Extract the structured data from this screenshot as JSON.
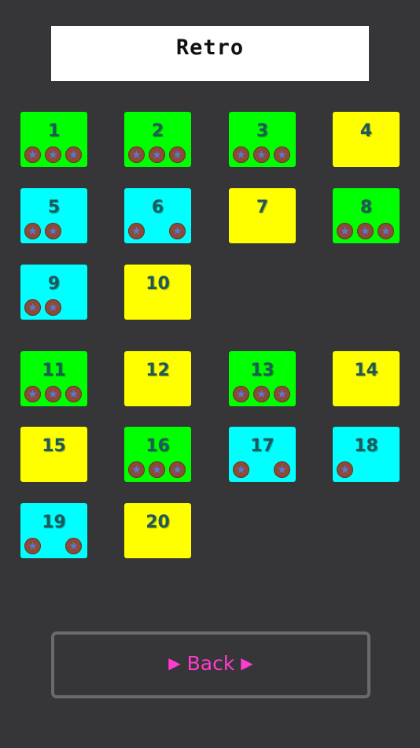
{
  "title": "Retro",
  "colors": {
    "background": "#363537",
    "complete": "#00ff00",
    "partial": "#00ffff",
    "unplayed": "#ffff00",
    "star_coin": "#8a4b38",
    "star": "#5a78d8",
    "back_text": "#ff3ccf"
  },
  "levels": [
    {
      "label": "1",
      "status": "complete",
      "stars": 3
    },
    {
      "label": "2",
      "status": "complete",
      "stars": 3
    },
    {
      "label": "3",
      "status": "complete",
      "stars": 3
    },
    {
      "label": "4",
      "status": "unplayed",
      "stars": 0
    },
    {
      "label": "5",
      "status": "partial",
      "stars": 2
    },
    {
      "label": "6",
      "status": "partial",
      "stars": 2,
      "star_slots": [
        0,
        2
      ]
    },
    {
      "label": "7",
      "status": "unplayed",
      "stars": 0
    },
    {
      "label": "8",
      "status": "complete",
      "stars": 3
    },
    {
      "label": "9",
      "status": "partial",
      "stars": 2
    },
    {
      "label": "10",
      "status": "unplayed",
      "stars": 0
    },
    {
      "label": "11",
      "status": "complete",
      "stars": 3
    },
    {
      "label": "12",
      "status": "unplayed",
      "stars": 0
    },
    {
      "label": "13",
      "status": "complete",
      "stars": 3
    },
    {
      "label": "14",
      "status": "unplayed",
      "stars": 0
    },
    {
      "label": "15",
      "status": "unplayed",
      "stars": 0
    },
    {
      "label": "16",
      "status": "complete",
      "stars": 3
    },
    {
      "label": "17",
      "status": "partial",
      "stars": 2,
      "star_slots": [
        0,
        2
      ]
    },
    {
      "label": "18",
      "status": "partial",
      "stars": 1
    },
    {
      "label": "19",
      "status": "partial",
      "stars": 2,
      "star_slots": [
        0,
        2
      ]
    },
    {
      "label": "20",
      "status": "unplayed",
      "stars": 0
    }
  ],
  "back_button": {
    "label": "Back",
    "arrow_left": "▶",
    "arrow_right": "▶"
  }
}
